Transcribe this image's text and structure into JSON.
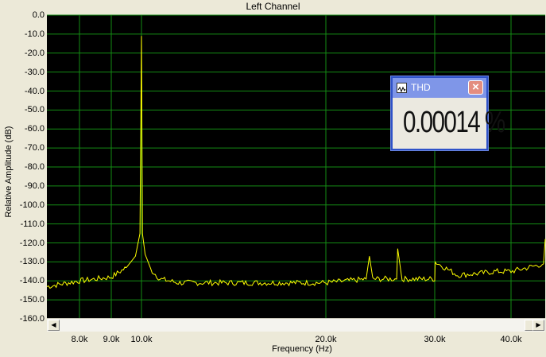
{
  "window": {
    "title": "Left Channel"
  },
  "thd": {
    "title": "THD",
    "value": "0.00014 %",
    "close_glyph": "×",
    "icon": "waveform-icon"
  },
  "scroll": {
    "left_glyph": "◀",
    "right_glyph": "▶"
  },
  "colors": {
    "plot_bg": "#000000",
    "grid": "#148c14",
    "trace": "#ffff00",
    "window_bg": "#ece9d8",
    "thd_title": "#7f96e8"
  },
  "chart_data": {
    "type": "line",
    "title": "Left Channel",
    "xlabel": "Frequency (Hz)",
    "ylabel": "Relative Amplitude (dB)",
    "ylim": [
      -160,
      0
    ],
    "xlim": [
      7000,
      44000
    ],
    "y_ticks": [
      "0.0",
      "-10.0",
      "-20.0",
      "-30.0",
      "-40.0",
      "-50.0",
      "-60.0",
      "-70.0",
      "-80.0",
      "-90.0",
      "-100.0",
      "-110.0",
      "-120.0",
      "-130.0",
      "-140.0",
      "-150.0",
      "-160.0"
    ],
    "x_ticks": [
      {
        "value": 8000,
        "label": "8.0k"
      },
      {
        "value": 9000,
        "label": "9.0k"
      },
      {
        "value": 10000,
        "label": "10.0k"
      },
      {
        "value": 20000,
        "label": "20.0k"
      },
      {
        "value": 30000,
        "label": "30.0k"
      },
      {
        "value": 40000,
        "label": "40.0k"
      }
    ],
    "grid": true,
    "series": [
      {
        "x": [
          7000,
          8000,
          9000,
          9500,
          9800,
          9950,
          10000,
          10050,
          10200,
          10500,
          11000,
          12000,
          14000,
          16000,
          18000,
          20000,
          22000,
          23700,
          24000,
          24300,
          25000,
          26500,
          26600,
          27000,
          30000,
          30050,
          33000,
          36000,
          38000,
          40000,
          42000,
          43800,
          44000
        ],
        "y": [
          -143,
          -140,
          -138,
          -133,
          -127,
          -115,
          -11,
          -115,
          -126,
          -134,
          -139,
          -141,
          -141,
          -141,
          -141,
          -141,
          -140,
          -139,
          -127,
          -139,
          -139,
          -139,
          -123,
          -139,
          -139,
          -130,
          -137,
          -136,
          -135,
          -135,
          -133,
          -131,
          -118
        ]
      }
    ]
  }
}
